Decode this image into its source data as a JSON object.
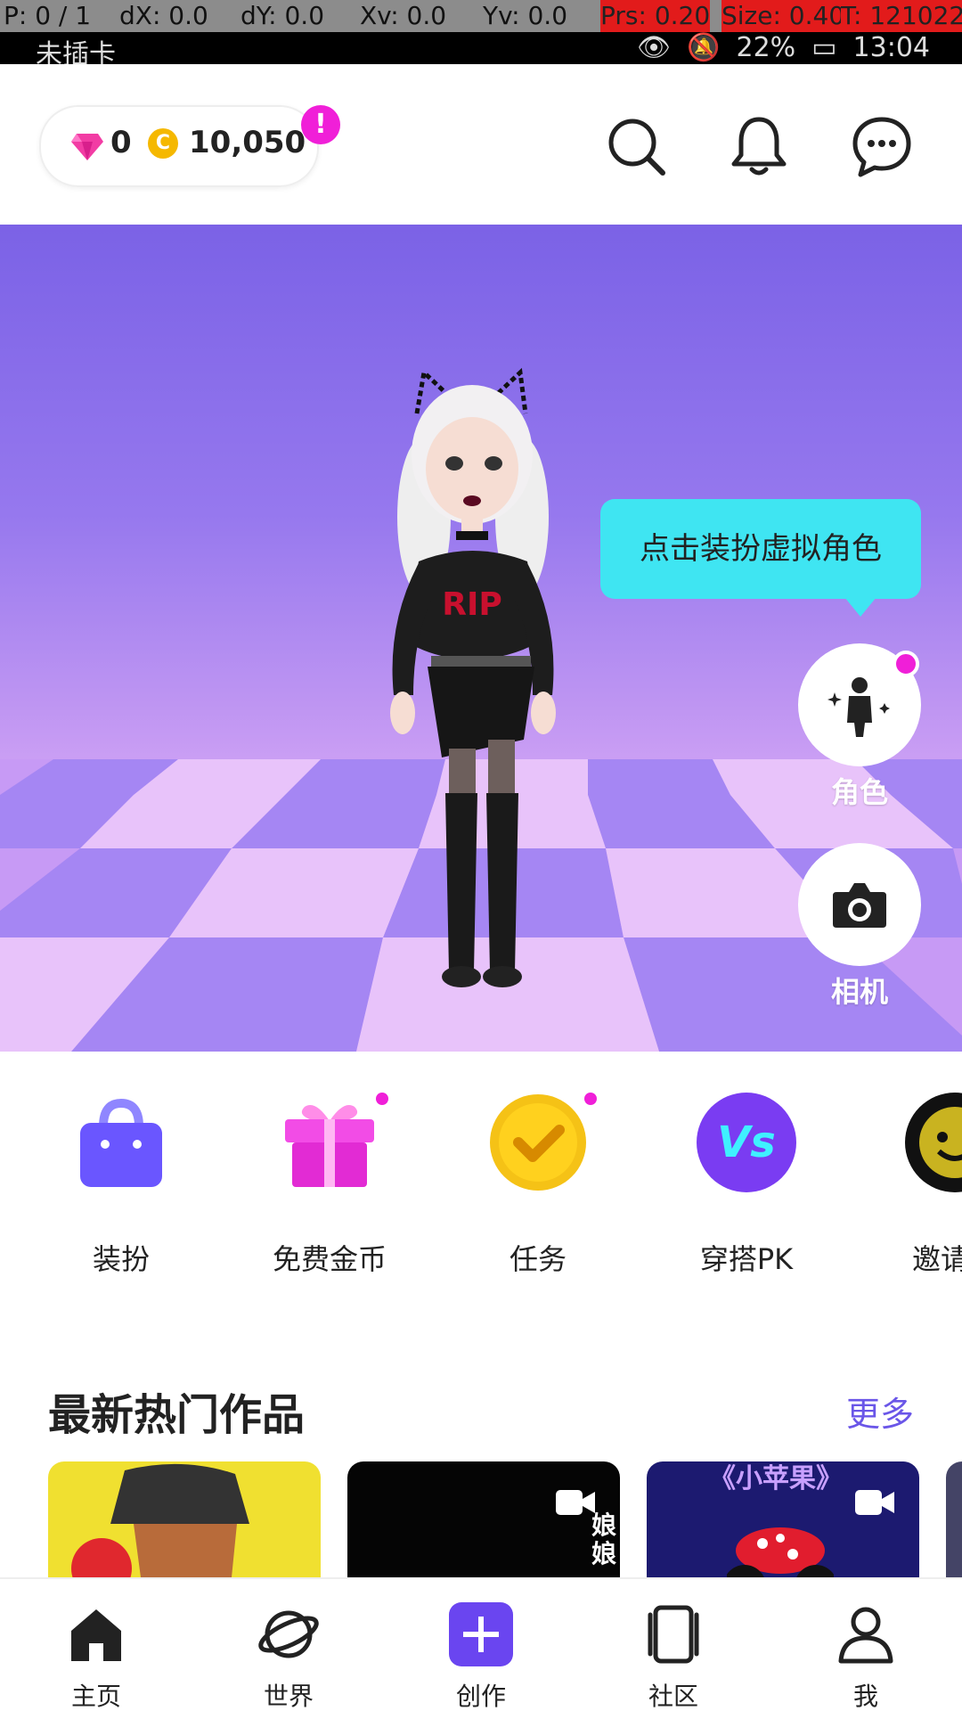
{
  "status_bar": {
    "debug": {
      "pointer": "P: 0 / 1",
      "dx": "dX: 0.0",
      "dy": "dY: 0.0",
      "xv": "Xv: 0.0",
      "yv": "Yv: 0.0",
      "prs": "Prs: 0.20",
      "size": "Size: 0.40",
      "touch": "T: 121022"
    },
    "carrier": "未插卡",
    "battery": "22%",
    "time": "13:04"
  },
  "header": {
    "gem_count": "0",
    "coin_symbol": "C",
    "coin_count": "10,050",
    "alert_symbol": "!"
  },
  "hero": {
    "tooltip": "点击装扮虚拟角色",
    "character_label": "角色",
    "camera_label": "相机",
    "shirt_text": "RIP"
  },
  "quick_actions": [
    {
      "label": "装扮"
    },
    {
      "label": "免费金币"
    },
    {
      "label": "任务"
    },
    {
      "label": "穿搭PK",
      "icon_text": "Vs"
    },
    {
      "label": "邀请有"
    }
  ],
  "section": {
    "title": "最新热门作品",
    "more": "更多",
    "card_texts": [
      "娘",
      "娘",
      "《小苹果》"
    ]
  },
  "bottom_nav": [
    {
      "label": "主页"
    },
    {
      "label": "世界"
    },
    {
      "label": "创作"
    },
    {
      "label": "社区"
    },
    {
      "label": "我"
    }
  ],
  "colors": {
    "accent": "#6a56e8",
    "pink": "#f01fd8",
    "tooltip": "#3fe5f2"
  }
}
